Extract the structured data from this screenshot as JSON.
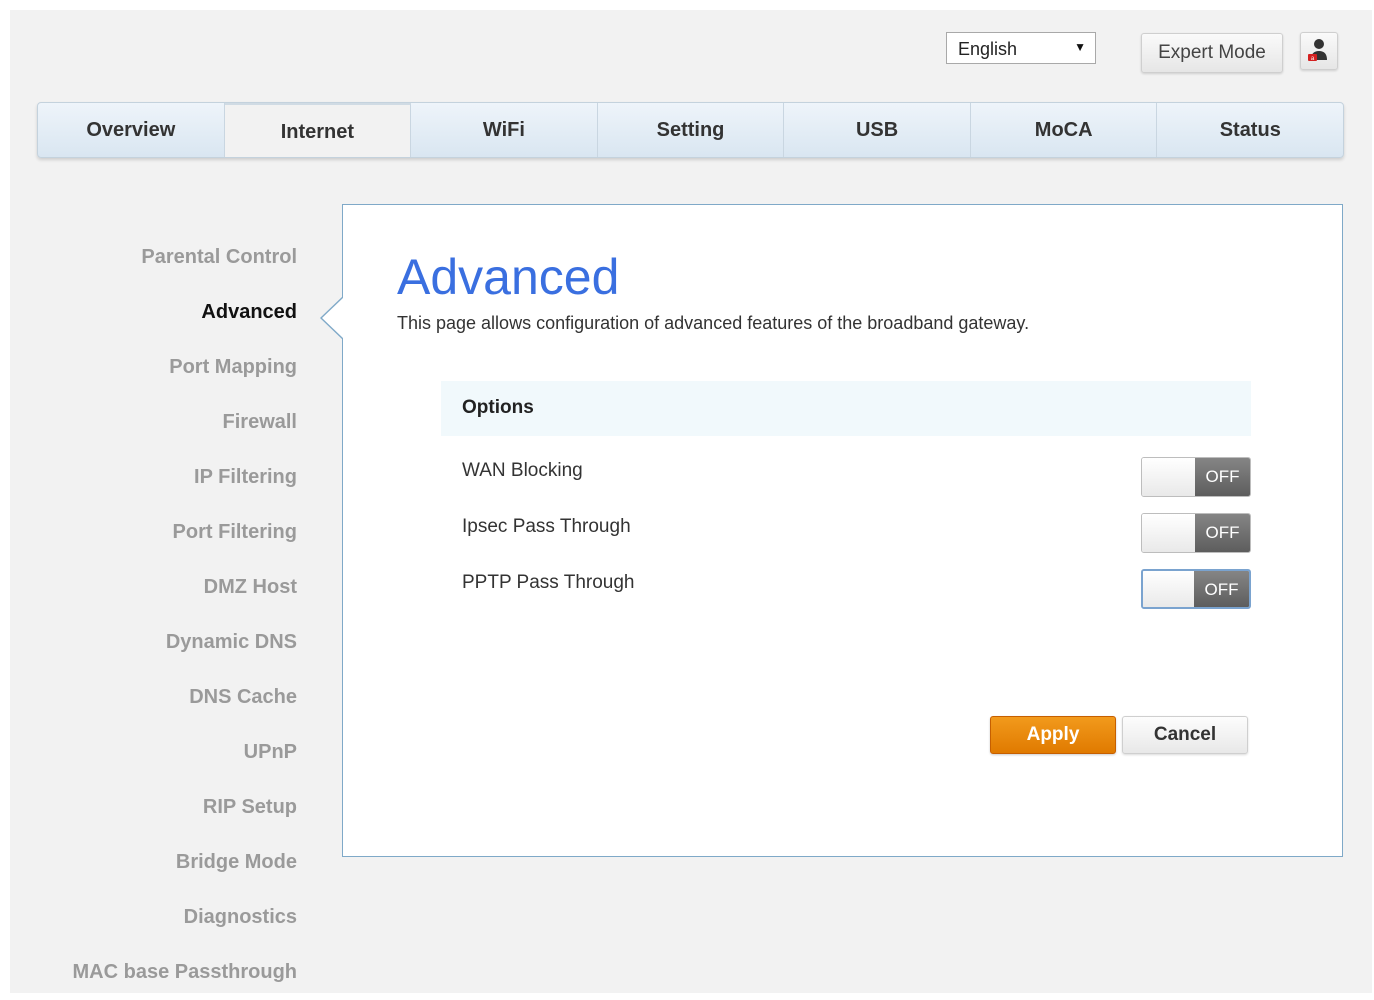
{
  "header": {
    "language": "English",
    "expert_mode_label": "Expert Mode",
    "user_icon": "user-icon"
  },
  "nav": {
    "items": [
      "Overview",
      "Internet",
      "WiFi",
      "Setting",
      "USB",
      "MoCA",
      "Status"
    ],
    "active": "Internet"
  },
  "sidebar": {
    "items": [
      "Parental Control",
      "Advanced",
      "Port Mapping",
      "Firewall",
      "IP Filtering",
      "Port Filtering",
      "DMZ Host",
      "Dynamic DNS",
      "DNS Cache",
      "UPnP",
      "RIP Setup",
      "Bridge Mode",
      "Diagnostics",
      "MAC base Passthrough"
    ],
    "active": "Advanced"
  },
  "main": {
    "title": "Advanced",
    "description": "This page allows configuration of advanced features of the broadband gateway.",
    "options_header": "Options",
    "options": [
      {
        "label": "WAN Blocking",
        "state": "OFF"
      },
      {
        "label": "Ipsec Pass Through",
        "state": "OFF"
      },
      {
        "label": "PPTP Pass Through",
        "state": "OFF"
      }
    ],
    "apply_label": "Apply",
    "cancel_label": "Cancel"
  },
  "colors": {
    "accent_title": "#3a6fe0",
    "apply_button": "#e88a0c",
    "panel_border": "#7fa9c8"
  }
}
